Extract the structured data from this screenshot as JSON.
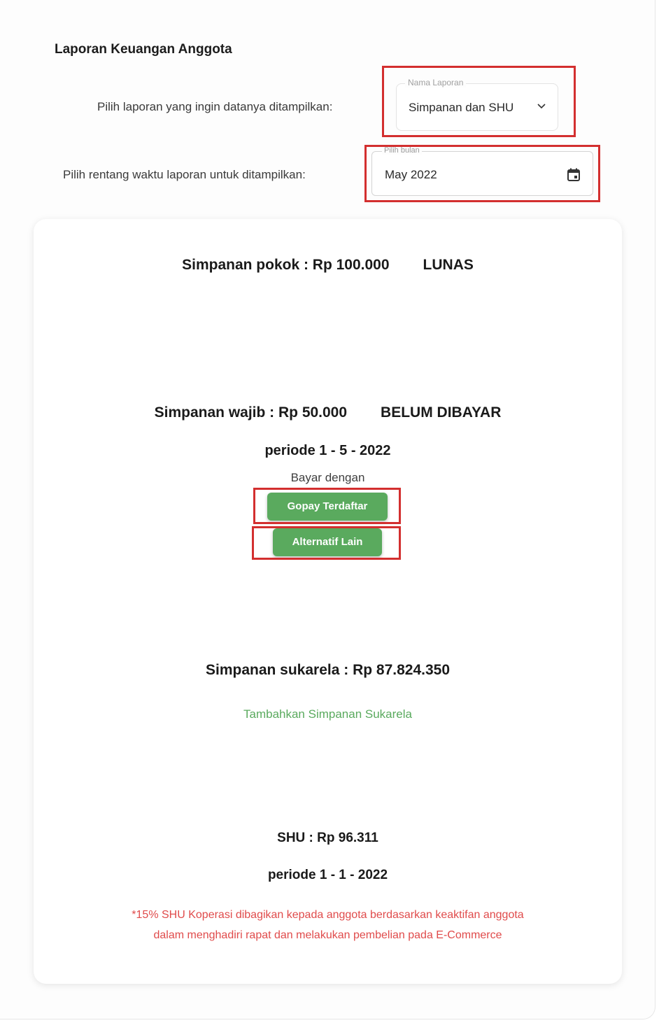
{
  "header": {
    "title": "Laporan Keuangan Anggota"
  },
  "filters": {
    "report_label": "Pilih laporan yang ingin datanya ditampilkan:",
    "report_select": {
      "legend": "Nama Laporan",
      "value": "Simpanan dan SHU",
      "icon": "chevron-down-icon"
    },
    "range_label": "Pilih rentang waktu laporan untuk ditampilkan:",
    "month_picker": {
      "legend": "Pilih bulan",
      "value": "May 2022",
      "icon": "calendar-icon"
    }
  },
  "report": {
    "pokok": {
      "label": "Simpanan pokok : Rp 100.000",
      "status": "LUNAS"
    },
    "wajib": {
      "label": "Simpanan wajib : Rp 50.000",
      "status": "BELUM DIBAYAR",
      "period": "periode 1 - 5 - 2022",
      "pay_with": "Bayar dengan",
      "pay_gopay_label": "Gopay Terdaftar",
      "pay_alt_label": "Alternatif Lain"
    },
    "sukarela": {
      "label": "Simpanan sukarela : Rp 87.824.350",
      "add_link": "Tambahkan Simpanan Sukarela"
    },
    "shu": {
      "label": "SHU : Rp 96.311",
      "period": "periode 1 - 1 - 2022",
      "note_line1": "*15% SHU Koperasi dibagikan kepada anggota berdasarkan keaktifan anggota",
      "note_line2": "dalam menghadiri rapat dan melakukan pembelian pada E-Commerce"
    }
  },
  "colors": {
    "accent_green": "#5aaa5e",
    "highlight_red": "#d32f2f",
    "note_red": "#e04b4b"
  }
}
